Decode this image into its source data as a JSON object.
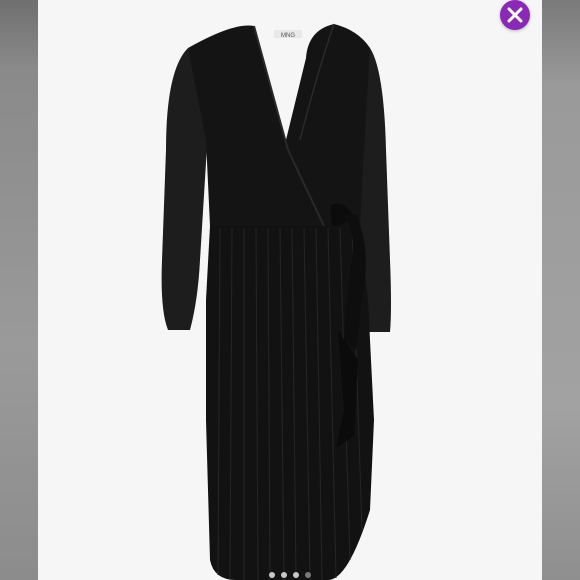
{
  "viewer": {
    "brand_label": "MNG",
    "close_icon": "close-icon",
    "accent_color": "#8a28b8",
    "carousel": {
      "dot_count": 4,
      "active_index": 3
    }
  }
}
